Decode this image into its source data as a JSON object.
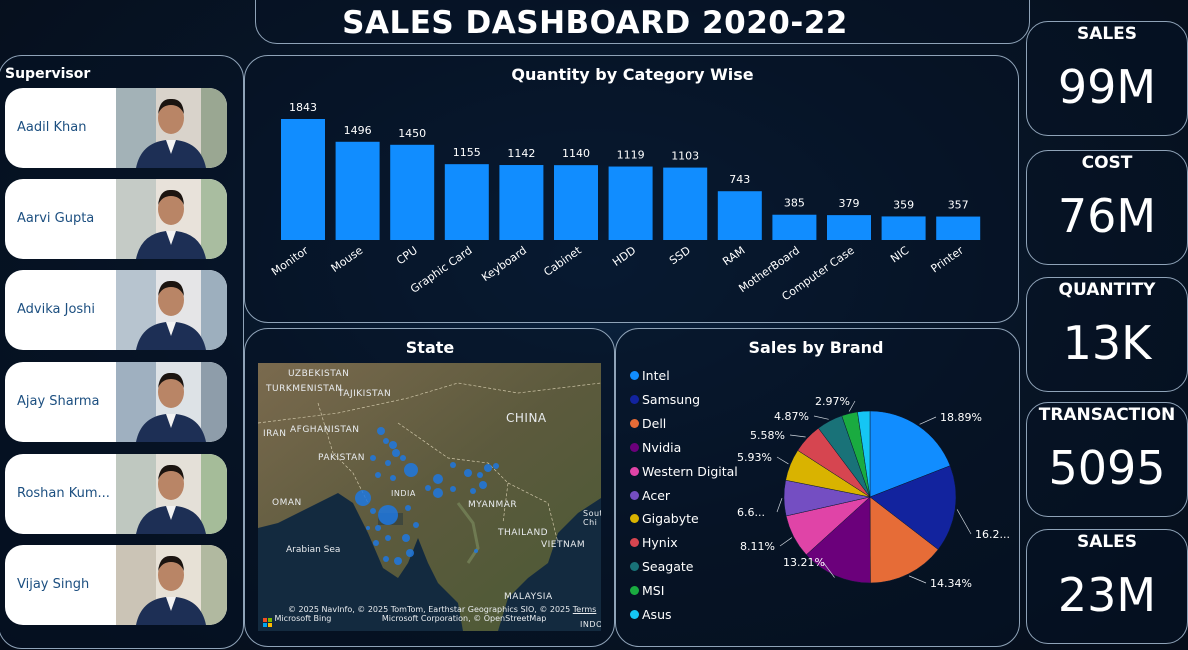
{
  "title": "SALES DASHBOARD 2020-22",
  "supervisor": {
    "heading": "Supervisor",
    "people": [
      {
        "name": "Aadil Khan"
      },
      {
        "name": "Aarvi Gupta"
      },
      {
        "name": "Advika Joshi"
      },
      {
        "name": "Ajay Sharma"
      },
      {
        "name": "Roshan Kum..."
      },
      {
        "name": "Vijay Singh"
      }
    ]
  },
  "chart_data": [
    {
      "type": "bar",
      "title": "Quantity by Category Wise",
      "categories": [
        "Monitor",
        "Mouse",
        "CPU",
        "Graphic Card",
        "Keyboard",
        "Cabinet",
        "HDD",
        "SSD",
        "RAM",
        "MotherBoard",
        "Computer Case",
        "NIC",
        "Printer"
      ],
      "values": [
        1843,
        1496,
        1450,
        1155,
        1142,
        1140,
        1119,
        1103,
        743,
        385,
        379,
        359,
        357
      ],
      "color": "#118dff",
      "ylim": [
        0,
        1843
      ]
    },
    {
      "type": "pie",
      "title": "Sales by Brand",
      "legend_position": "left",
      "slices": [
        {
          "name": "Intel",
          "value": 18.89,
          "label": "18.89%",
          "color": "#118dff"
        },
        {
          "name": "Samsung",
          "value": 16.2,
          "label": "16.2...",
          "color": "#12239e"
        },
        {
          "name": "Dell",
          "value": 14.34,
          "label": "14.34%",
          "color": "#e66c37"
        },
        {
          "name": "Nvidia",
          "value": 13.21,
          "label": "13.21%",
          "color": "#6b007b"
        },
        {
          "name": "Western Digital",
          "value": 8.11,
          "label": "8.11%",
          "color": "#e044a7"
        },
        {
          "name": "Acer",
          "value": 6.6,
          "label": "6.6...",
          "color": "#744ec2"
        },
        {
          "name": "Gigabyte",
          "value": 5.93,
          "label": "5.93%",
          "color": "#d9b300"
        },
        {
          "name": "Hynix",
          "value": 5.58,
          "label": "5.58%",
          "color": "#d64550"
        },
        {
          "name": "Seagate",
          "value": 4.87,
          "label": "4.87%",
          "color": "#197278"
        },
        {
          "name": "MSI",
          "value": 2.97,
          "label": "2.97%",
          "color": "#1aab40"
        },
        {
          "name": "Asus",
          "value": 2.3,
          "label": "",
          "color": "#15c6f4"
        }
      ]
    }
  ],
  "map": {
    "title": "State",
    "labels": [
      "UZBEKISTAN",
      "TURKMENISTAN",
      "TAJIKISTAN",
      "IRAN",
      "AFGHANISTAN",
      "CHINA",
      "PAKISTAN",
      "INDIA",
      "OMAN",
      "MYANMAR",
      "THAILAND",
      "VIETNAM",
      "Arabian Sea",
      "MALAYSIA",
      "South Chi",
      "INDO"
    ],
    "attribution": "© 2025 NavInfo, © 2025 TomTom, Earthstar Geographics SIO, © 2025",
    "attribution_link": "Terms",
    "attribution2": "Microsoft Corporation, © OpenStreetMap",
    "bing": "Microsoft Bing"
  },
  "kpis": [
    {
      "label": "SALES",
      "value": "99M"
    },
    {
      "label": "COST",
      "value": "76M"
    },
    {
      "label": "QUANTITY",
      "value": "13K"
    },
    {
      "label": "TRANSACTION",
      "value": "5095"
    },
    {
      "label": "SALES",
      "value": "23M"
    }
  ]
}
